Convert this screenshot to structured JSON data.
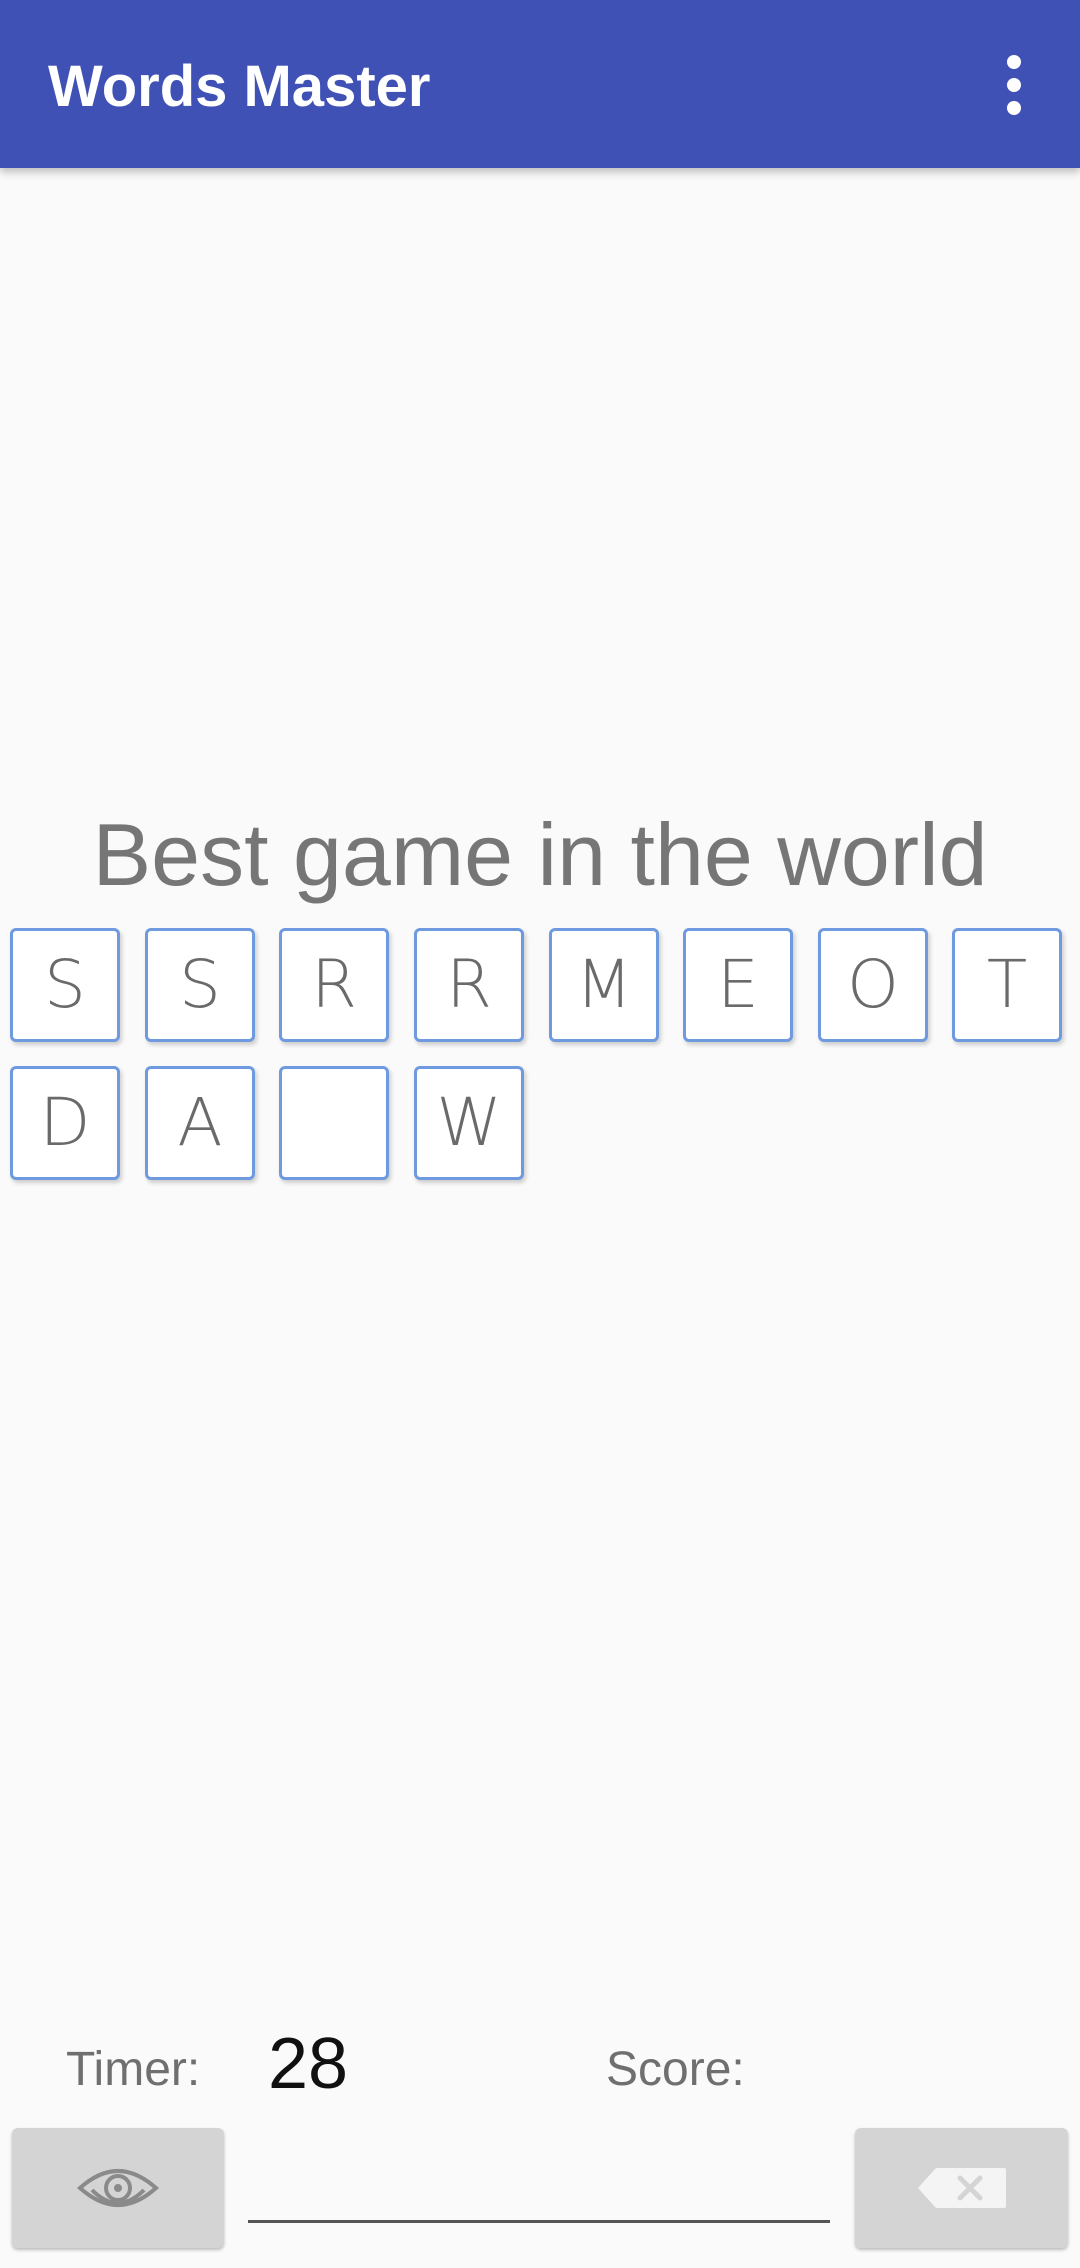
{
  "app_bar": {
    "title": "Words Master",
    "background_color": "#3f51b5",
    "menu_icon": "more-vert-icon"
  },
  "slogan": "Best game in the world",
  "letter_tiles": [
    "S",
    "S",
    "R",
    "R",
    "M",
    "E",
    "O",
    "T",
    "D",
    "A",
    "",
    "W"
  ],
  "tile_border_color": "#6f9ae0",
  "status": {
    "timer_label": "Timer:",
    "timer_value": "28",
    "score_label": "Score:",
    "score_value": ""
  },
  "controls": {
    "reveal_icon": "eye-icon",
    "backspace_icon": "backspace-icon",
    "answer_value": ""
  }
}
